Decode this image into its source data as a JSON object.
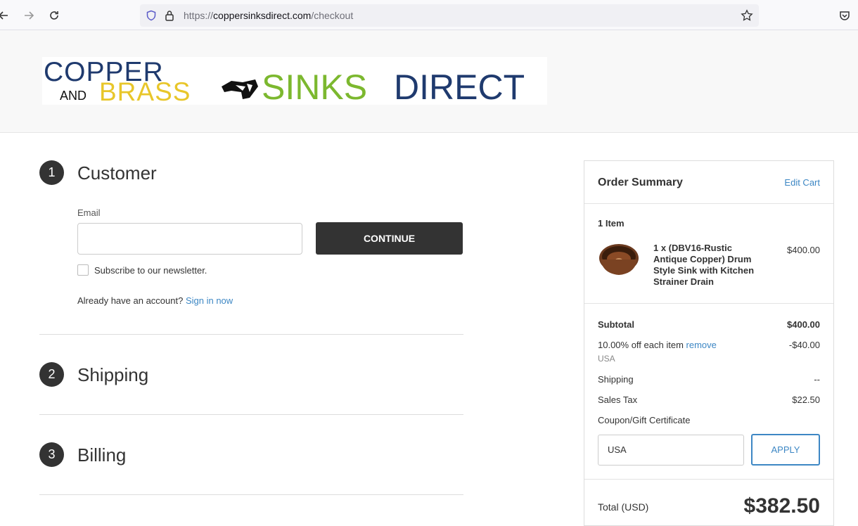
{
  "browser": {
    "url_prefix": "https://",
    "url_domain": "coppersinksdirect.com",
    "url_path": "/checkout"
  },
  "logo": {
    "line1": "COPPER",
    "and": "AND",
    "brass": "BRASS",
    "sinks": "SINKS",
    "direct": "DIRECT"
  },
  "steps": [
    {
      "number": "1",
      "title": "Customer"
    },
    {
      "number": "2",
      "title": "Shipping"
    },
    {
      "number": "3",
      "title": "Billing"
    }
  ],
  "customer": {
    "email_label": "Email",
    "email_value": "",
    "continue_label": "CONTINUE",
    "newsletter_label": "Subscribe to our newsletter.",
    "account_prompt": "Already have an account?",
    "sign_in_label": "Sign in now"
  },
  "summary": {
    "title": "Order Summary",
    "edit_cart": "Edit Cart",
    "item_count": "1 Item",
    "item_name": "1 x (DBV16-Rustic Antique Copper) Drum Style Sink with Kitchen Strainer Drain",
    "item_price": "$400.00",
    "subtotal_label": "Subtotal",
    "subtotal_value": "$400.00",
    "discount_label": "10.00% off each item",
    "discount_remove": "remove",
    "discount_code": "USA",
    "discount_value": "-$40.00",
    "shipping_label": "Shipping",
    "shipping_value": "--",
    "tax_label": "Sales Tax",
    "tax_value": "$22.50",
    "coupon_link": "Coupon/Gift Certificate",
    "coupon_value": "USA",
    "apply_label": "APPLY",
    "total_label": "Total (USD)",
    "total_value": "$382.50"
  },
  "colors": {
    "accent": "#3d87c4",
    "dark_button": "#333333",
    "logo_blue": "#1f3a6e",
    "logo_green": "#7cb82f",
    "logo_yellow": "#e8c62a"
  }
}
